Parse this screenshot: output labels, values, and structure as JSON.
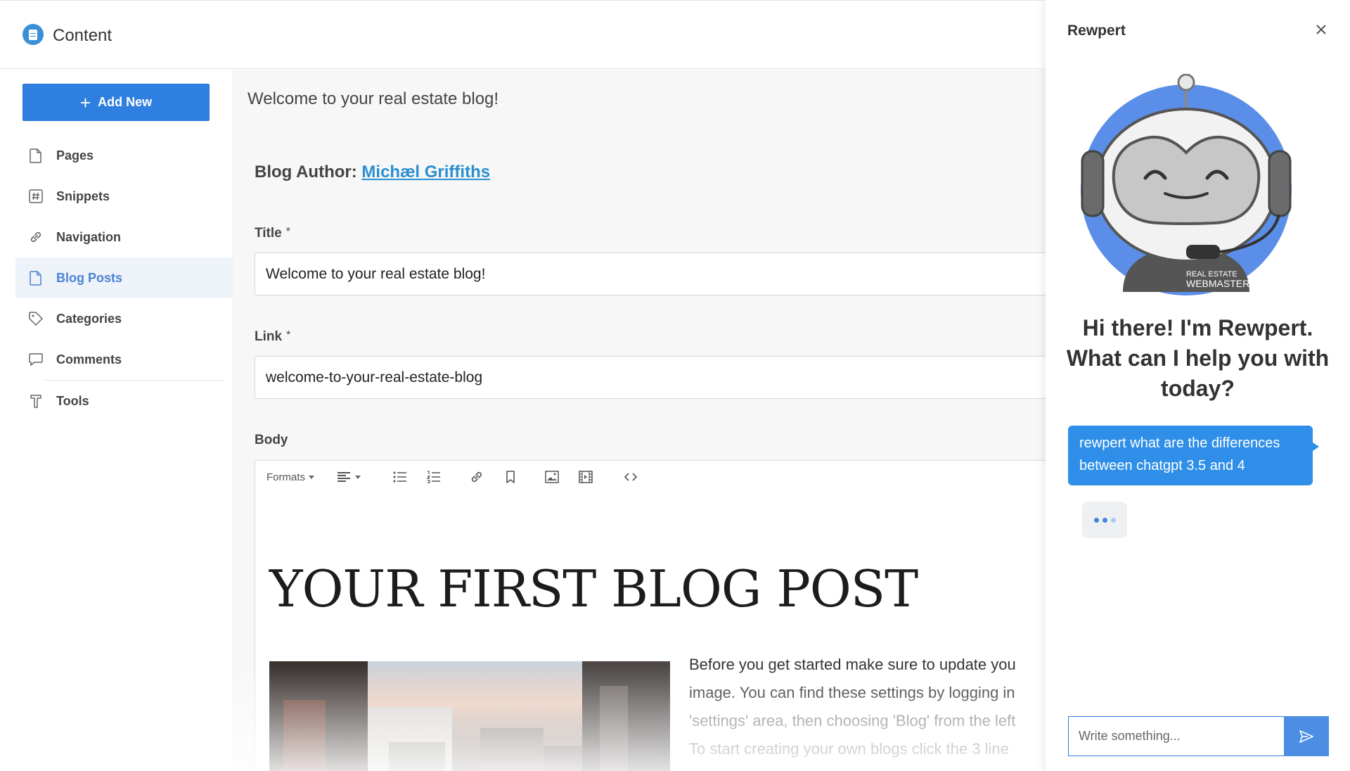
{
  "header": {
    "app_title": "Content",
    "logo_icon": "document-icon"
  },
  "sidebar": {
    "add_new_label": "Add New",
    "items": [
      {
        "label": "Pages",
        "icon": "page-icon",
        "active": false
      },
      {
        "label": "Snippets",
        "icon": "hash-icon",
        "active": false
      },
      {
        "label": "Navigation",
        "icon": "link-icon",
        "active": false
      },
      {
        "label": "Blog Posts",
        "icon": "page-icon",
        "active": true
      },
      {
        "label": "Categories",
        "icon": "tag-icon",
        "active": false
      },
      {
        "label": "Comments",
        "icon": "comment-icon",
        "active": false
      },
      {
        "label": "Tools",
        "icon": "tools-icon",
        "active": false
      }
    ]
  },
  "main": {
    "page_heading": "Welcome to your real estate blog!",
    "author_prefix": "Blog Author:",
    "author_name": "Michæl Griffiths",
    "title_label": "Title",
    "title_value": "Welcome to your real estate blog!",
    "link_label": "Link",
    "link_value": "welcome-to-your-real-estate-blog",
    "body_label": "Body",
    "required_mark": "*",
    "toolbar": {
      "formats_label": "Formats",
      "tools": [
        "align-icon",
        "bullet-list-icon",
        "numbered-list-icon",
        "link-icon",
        "bookmark-icon",
        "image-icon",
        "media-icon",
        "code-icon"
      ]
    },
    "editor": {
      "heading": "YOUR FIRST BLOG POST",
      "paragraph_lines": [
        "Before you get started make sure to update you",
        "image. You can find these settings by logging in",
        "'settings' area, then choosing  'Blog' from the left",
        "To start creating your own blogs click the 3 line"
      ]
    }
  },
  "panel": {
    "title": "Rewpert",
    "greeting": "Hi there! I'm Rewpert. What can I help you with today?",
    "robot_badge_line1": "REAL ESTATE",
    "robot_badge_line2": "WEBMASTERS",
    "user_message": "rewpert what are the differences between chatgpt 3.5 and 4",
    "input_placeholder": "Write something...",
    "colors": {
      "accent": "#2f8fe8",
      "robot_ring": "#5b8ee8"
    }
  }
}
